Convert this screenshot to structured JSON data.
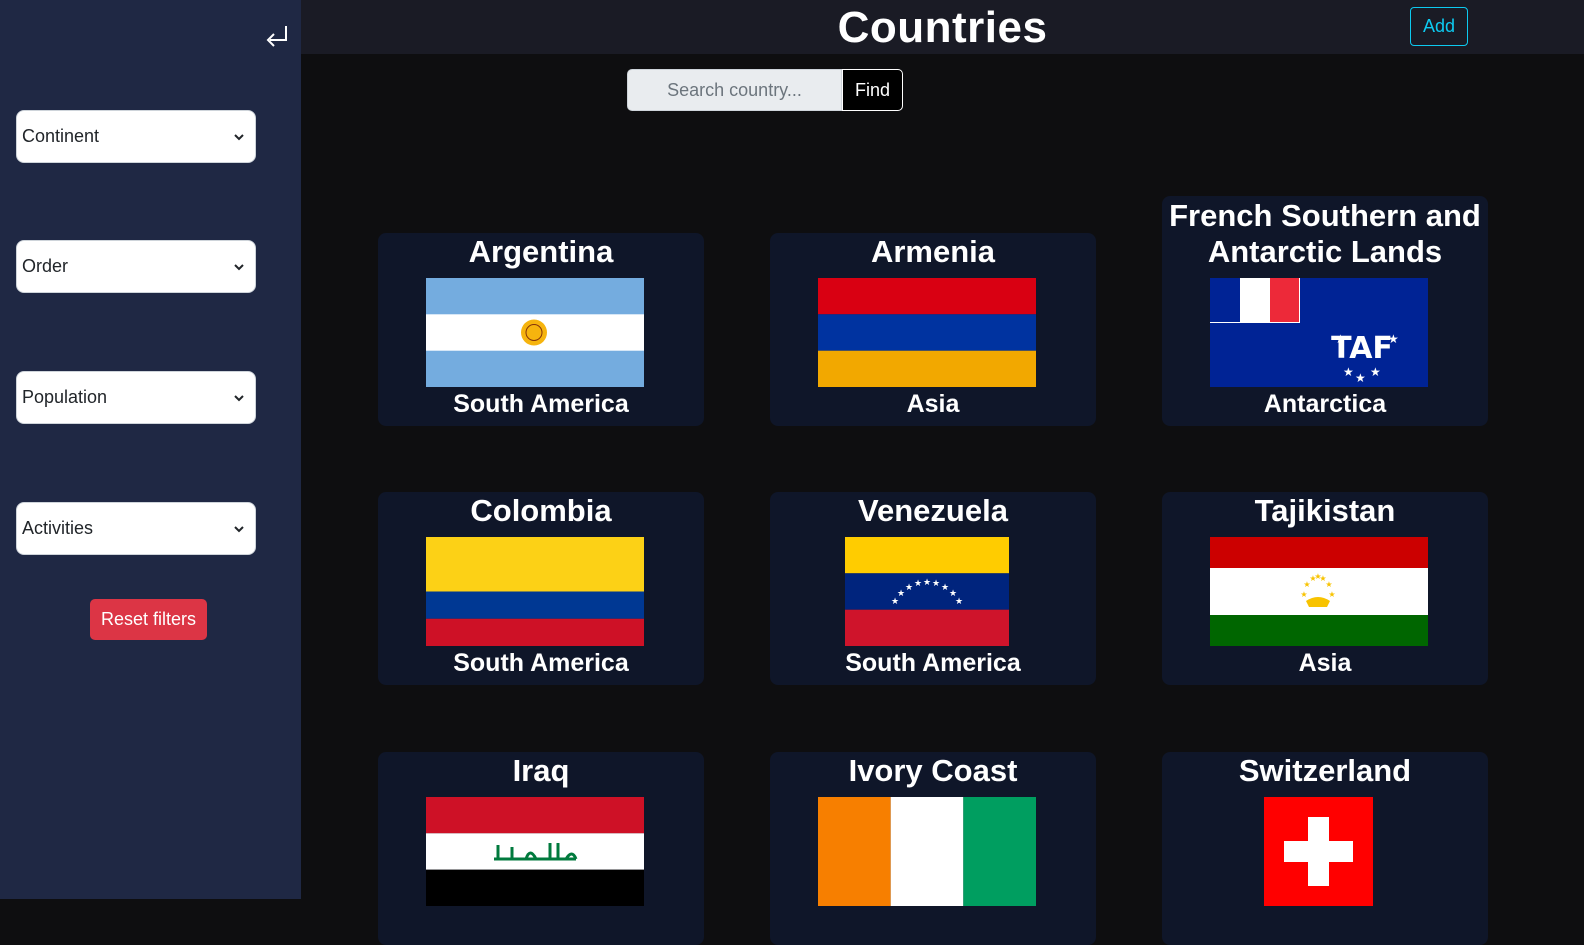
{
  "sidebar": {
    "filters": [
      {
        "label": "Continent"
      },
      {
        "label": "Order"
      },
      {
        "label": "Population"
      },
      {
        "label": "Activities"
      }
    ],
    "reset_label": "Reset filters",
    "back_icon": "return-arrow-icon"
  },
  "header": {
    "title": "Countries",
    "add_label": "Add"
  },
  "search": {
    "placeholder": "Search country...",
    "value": "",
    "find_label": "Find"
  },
  "countries": [
    {
      "name": "Argentina",
      "continent": "South America",
      "flag_icon": "argentina-flag-icon"
    },
    {
      "name": "Armenia",
      "continent": "Asia",
      "flag_icon": "armenia-flag-icon"
    },
    {
      "name": "French Southern and Antarctic Lands",
      "continent": "Antarctica",
      "flag_icon": "french-southern-lands-flag-icon"
    },
    {
      "name": "Colombia",
      "continent": "South America",
      "flag_icon": "colombia-flag-icon"
    },
    {
      "name": "Venezuela",
      "continent": "South America",
      "flag_icon": "venezuela-flag-icon"
    },
    {
      "name": "Tajikistan",
      "continent": "Asia",
      "flag_icon": "tajikistan-flag-icon"
    },
    {
      "name": "Iraq",
      "continent": "",
      "flag_icon": "iraq-flag-icon"
    },
    {
      "name": "Ivory Coast",
      "continent": "",
      "flag_icon": "ivory-coast-flag-icon"
    },
    {
      "name": "Switzerland",
      "continent": "",
      "flag_icon": "switzerland-flag-icon"
    }
  ],
  "colors": {
    "sidebar_bg": "#1f2844",
    "header_bg": "#1a1b25",
    "card_bg": "#0f1629",
    "reset_red": "#dc3545",
    "add_cyan": "#0dcaf0"
  }
}
